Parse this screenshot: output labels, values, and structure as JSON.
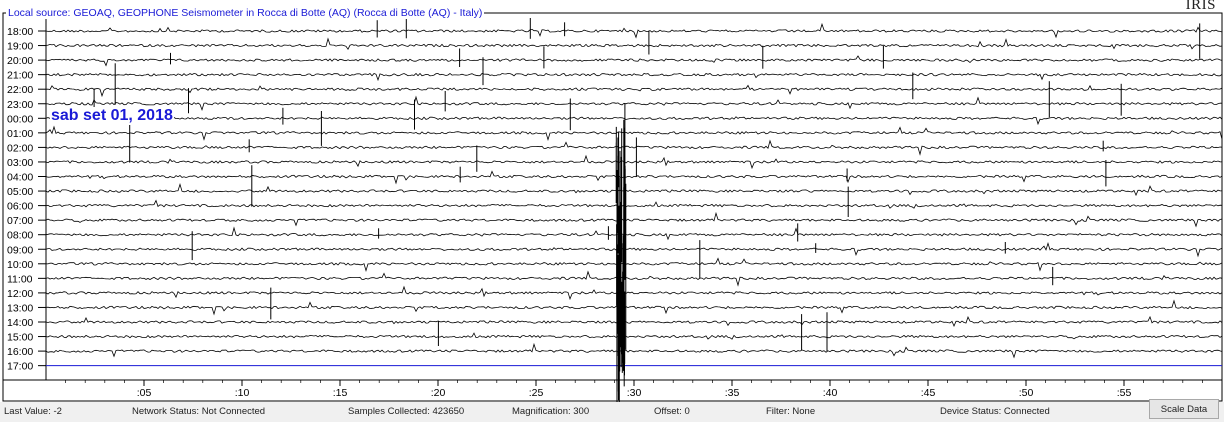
{
  "brand": "IRIS",
  "source_title": "Local source: GEOAQ, GEOPHONE Seismometer in Rocca di Botte (AQ) (Rocca di Botte (AQ) - Italy)",
  "date_label": "sab set 01, 2018",
  "hour_labels": [
    "18:00",
    "19:00",
    "20:00",
    "21:00",
    "22:00",
    "23:00",
    "00:00",
    "01:00",
    "02:00",
    "03:00",
    "04:00",
    "05:00",
    "06:00",
    "07:00",
    "08:00",
    "09:00",
    "10:00",
    "11:00",
    "12:00",
    "13:00",
    "14:00",
    "15:00",
    "16:00",
    "17:00"
  ],
  "minute_labels": [
    ":05",
    ":10",
    ":15",
    ":20",
    ":25",
    ":30",
    ":35",
    ":40",
    ":45",
    ":50",
    ":55"
  ],
  "status": {
    "last_value": "Last Value:  -2",
    "network": "Network Status:  Not Connected",
    "samples": "Samples Collected:  423650",
    "magnification": "Magnification:  300",
    "offset": "Offset:  0",
    "filter": "Filter:  None",
    "device": "Device Status:  Connected"
  },
  "scale_button": "Scale Data",
  "colors": {
    "trace": "#000000",
    "accent": "#1a1ad6",
    "grid": "#000000"
  }
}
